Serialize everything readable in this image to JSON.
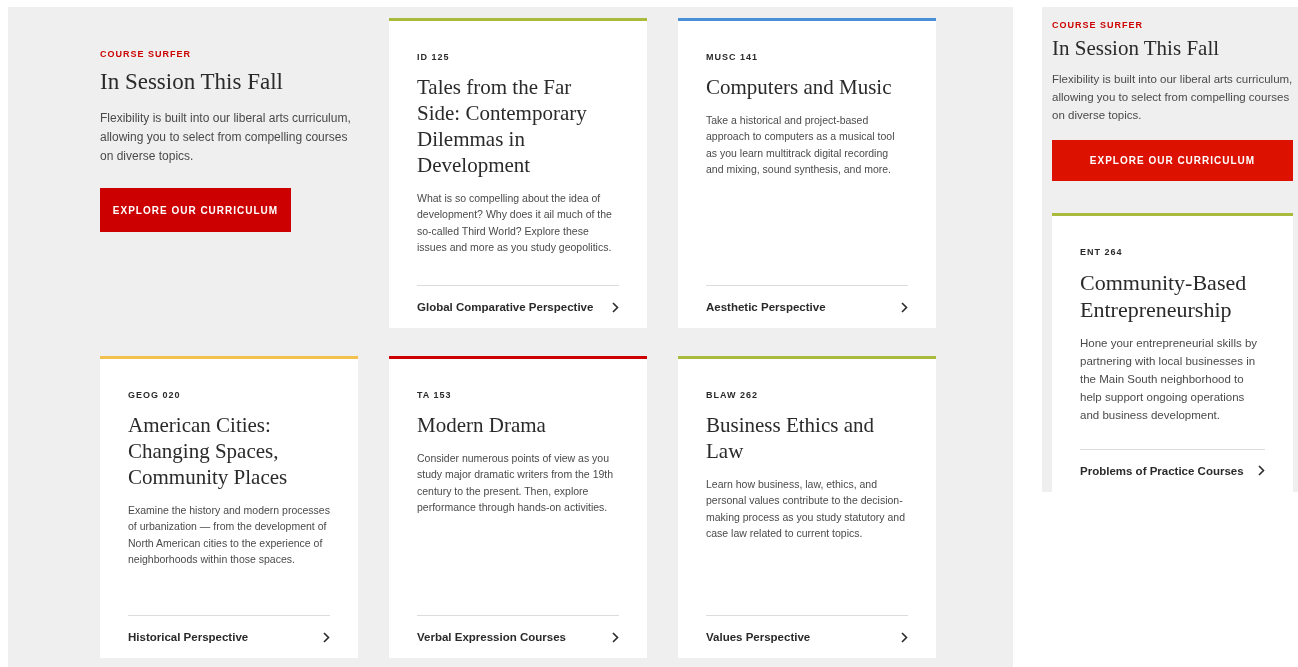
{
  "main": {
    "intro": {
      "eyebrow": "COURSE SURFER",
      "title": "In Session This Fall",
      "description": "Flexibility is built into our liberal arts curriculum, allowing you to select from compelling courses on diverse topics.",
      "button": "EXPLORE OUR CURRICULUM"
    },
    "courses": [
      {
        "code": "ID 125",
        "title": "Tales from the Far Side: Contemporary Dilemmas in Development",
        "description": "What is so compelling about the idea of development? Why does it ail much of the so-called Third World? Explore these issues and more as you study geopolitics.",
        "link": "Global Comparative Perspective",
        "color": "#a9ba3c"
      },
      {
        "code": "MUSC 141",
        "title": "Computers and Music",
        "description": "Take a historical and project-based approach to computers as a musical tool as you learn multitrack digital recording and mixing, sound synthesis, and more.",
        "link": "Aesthetic Perspective",
        "color": "#4a90d9"
      },
      {
        "code": "GEOG 020",
        "title": "American Cities: Changing Spaces, Community Places",
        "description": "Examine the history and modern processes of urbanization — from the development of North American cities to the experience of neighborhoods within those spaces.",
        "link": "Historical Perspective",
        "color": "#f2c14e"
      },
      {
        "code": "TA 153",
        "title": "Modern Drama",
        "description": "Consider numerous points of view as you study major dramatic writers from the 19th century to the present. Then, explore performance through hands-on activities.",
        "link": "Verbal Expression Courses",
        "color": "#cc0000"
      },
      {
        "code": "BLAW 262",
        "title": "Business Ethics and Law",
        "description": "Learn how business, law, ethics, and personal values contribute to the decision-making process as you study statutory and case law related to current topics.",
        "link": "Values Perspective",
        "color": "#a9ba3c"
      }
    ]
  },
  "side": {
    "intro": {
      "eyebrow": "COURSE SURFER",
      "title": "In Session This Fall",
      "description": "Flexibility is built into our liberal arts curriculum, allowing you to select from compelling courses on diverse topics.",
      "button": "EXPLORE OUR CURRICULUM"
    },
    "course": {
      "code": "ENT 264",
      "title": "Community-Based Entrepreneurship",
      "description": "Hone your entrepreneurial skills by partnering with local businesses in the Main South neighborhood to help support ongoing operations and business development.",
      "link": "Problems of Practice Courses",
      "color": "#a9ba3c"
    }
  }
}
